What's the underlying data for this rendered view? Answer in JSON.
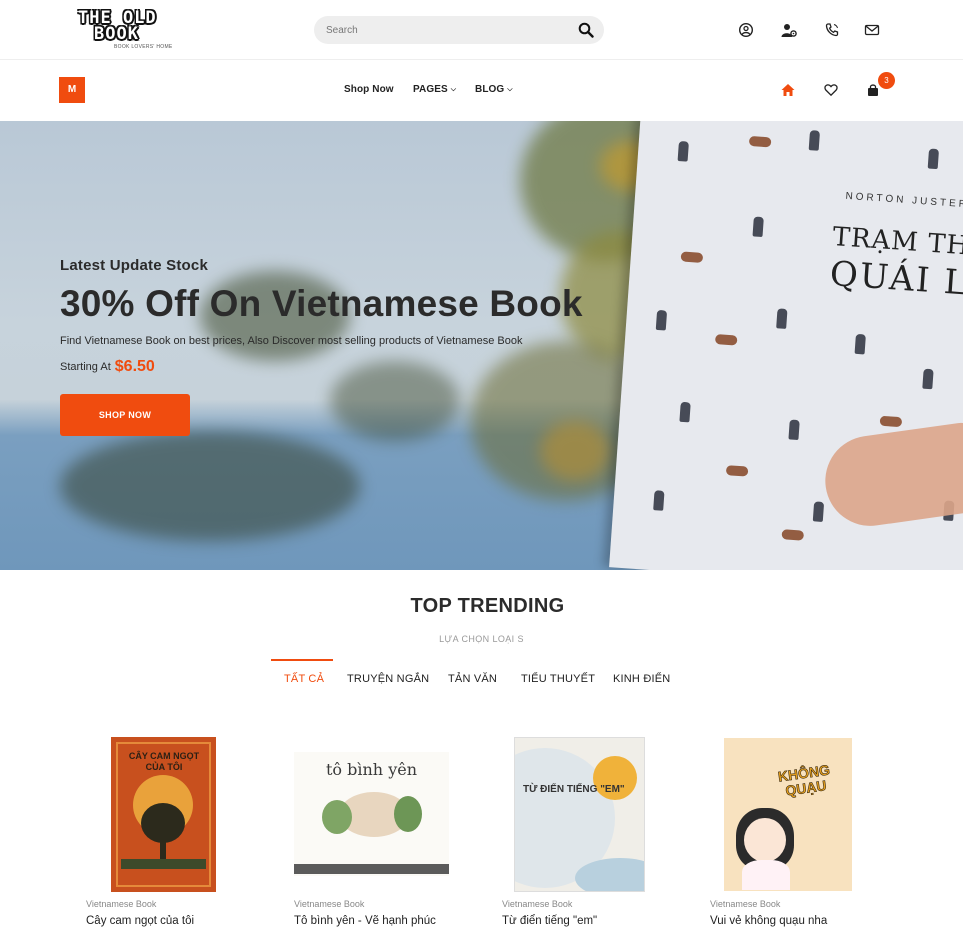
{
  "header": {
    "logo_line1": "THE OLD",
    "logo_line2": "BOOK",
    "logo_tagline": "BOOK LOVERS' HOME",
    "search_placeholder": "Search"
  },
  "icons": {
    "search": "search-icon",
    "account": "user-circle-icon",
    "user_settings": "user-gear-icon",
    "phone": "phone-icon",
    "mail": "envelope-icon",
    "home": "home-icon",
    "wishlist": "heart-icon",
    "cart": "shopping-bag-icon"
  },
  "nav": {
    "menu_label": "M",
    "links": [
      "Shop Now",
      "PAGES",
      "BLOG"
    ],
    "cart_count": "3"
  },
  "hero": {
    "subtitle": "Latest Update Stock",
    "title": "30% Off On Vietnamese Book",
    "description": "Find Vietnamese Book on best prices, Also Discover most selling products of Vietnamese Book",
    "starting_label": "Starting At",
    "price": "$6.50",
    "button": "SHOP NOW",
    "book_author": "NORTON JUSTER",
    "book_title_line1": "TRẠM THU PHÍ",
    "book_title_line2": "QUÁI LẠ"
  },
  "trending": {
    "title": "TOP TRENDING",
    "subtitle": "LỰA CHỌN LOẠI S",
    "tabs": [
      "TẤT CẢ",
      "TRUYỆN NGẮN",
      "TẢN VĂN",
      "TIỂU THUYẾT",
      "KINH ĐIỂN"
    ],
    "active_tab": 0
  },
  "products": [
    {
      "category": "Vietnamese Book",
      "name": "Cây cam ngọt của tôi",
      "cover_text": "CÂY CAM NGỌT CỦA TÔI"
    },
    {
      "category": "Vietnamese Book",
      "name": "Tô bình yên - Vẽ hạnh phúc",
      "cover_text": "tô bình yên"
    },
    {
      "category": "Vietnamese Book",
      "name": "Từ điển tiếng \"em\"",
      "cover_text": "TỪ ĐIỂN TIẾNG \"EM\""
    },
    {
      "category": "Vietnamese Book",
      "name": "Vui vẻ không quạu nha",
      "cover_text": "KHÔNG QUẠU"
    }
  ],
  "colors": {
    "accent": "#f04c0f",
    "text": "#2b2b2b",
    "muted": "#888888"
  }
}
